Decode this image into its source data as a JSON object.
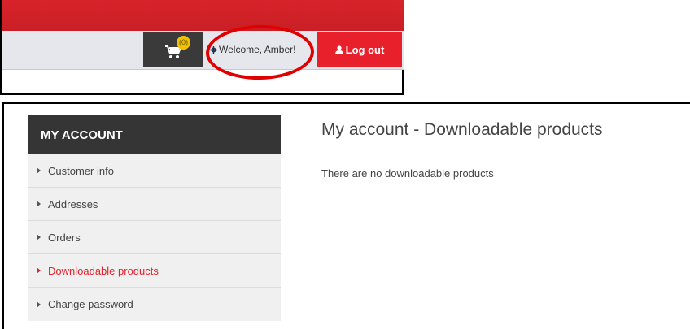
{
  "header": {
    "cart": {
      "count": "(0)",
      "icon": "cart-icon"
    },
    "welcome_text": "Welcome, Amber!",
    "welcome_icon": "gear-icon",
    "logout_label": "Log out",
    "logout_icon": "user-icon",
    "brand_color": "#d8232a",
    "highlight_color": "#e00000"
  },
  "sidebar": {
    "title": "MY ACCOUNT",
    "items": [
      {
        "label": "Customer info",
        "active": false
      },
      {
        "label": "Addresses",
        "active": false
      },
      {
        "label": "Orders",
        "active": false
      },
      {
        "label": "Downloadable products",
        "active": true
      },
      {
        "label": "Change password",
        "active": false
      }
    ],
    "active_color": "#e4232b"
  },
  "main": {
    "title": "My account - Downloadable products",
    "message": "There are no downloadable products"
  }
}
